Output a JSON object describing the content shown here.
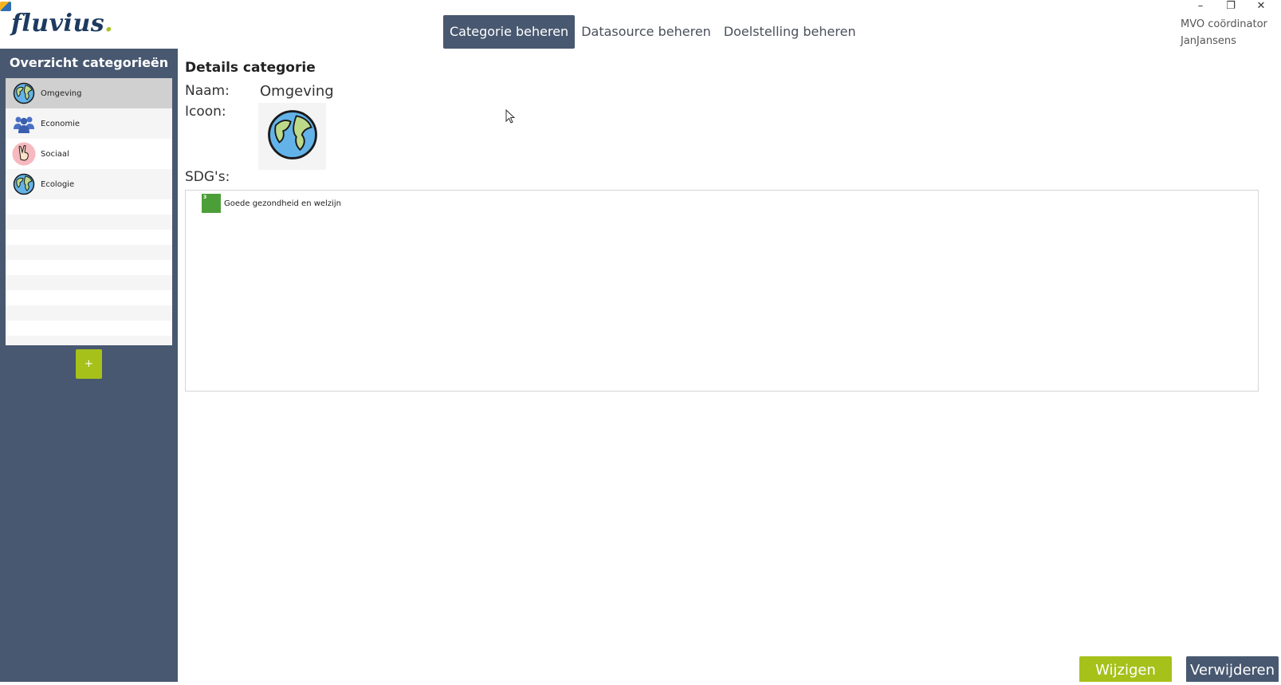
{
  "app": {
    "logo_text": "fluvius",
    "logo_dot": ".",
    "window_controls": [
      "–",
      "❐",
      "✕"
    ]
  },
  "nav": {
    "tabs": [
      {
        "label": "Categorie beheren",
        "active": true
      },
      {
        "label": "Datasource beheren",
        "active": false
      },
      {
        "label": "Doelstelling beheren",
        "active": false
      }
    ]
  },
  "user": {
    "role": "MVO coördinator",
    "name": "JanJansens"
  },
  "sidebar": {
    "title": "Overzicht categorieën",
    "items": [
      {
        "label": "Omgeving",
        "icon": "globe-icon",
        "selected": true
      },
      {
        "label": "Economie",
        "icon": "people-icon",
        "selected": false
      },
      {
        "label": "Sociaal",
        "icon": "peace-hand-icon",
        "selected": false
      },
      {
        "label": "Ecologie",
        "icon": "globe-icon",
        "selected": false
      }
    ],
    "add_label": "+"
  },
  "details": {
    "title": "Details categorie",
    "name_label": "Naam:",
    "name_value": "Omgeving",
    "icon_label": "Icoon:",
    "icon_value": "globe-icon",
    "sdg_label": "SDG's:",
    "sdgs": [
      {
        "number": "3",
        "label": "Goede gezondheid en welzijn",
        "color": "#4c9f38"
      }
    ]
  },
  "actions": {
    "edit_label": "Wijzigen",
    "delete_label": "Verwijderen"
  },
  "colors": {
    "primary": "#485870",
    "accent": "#a6c11a"
  }
}
